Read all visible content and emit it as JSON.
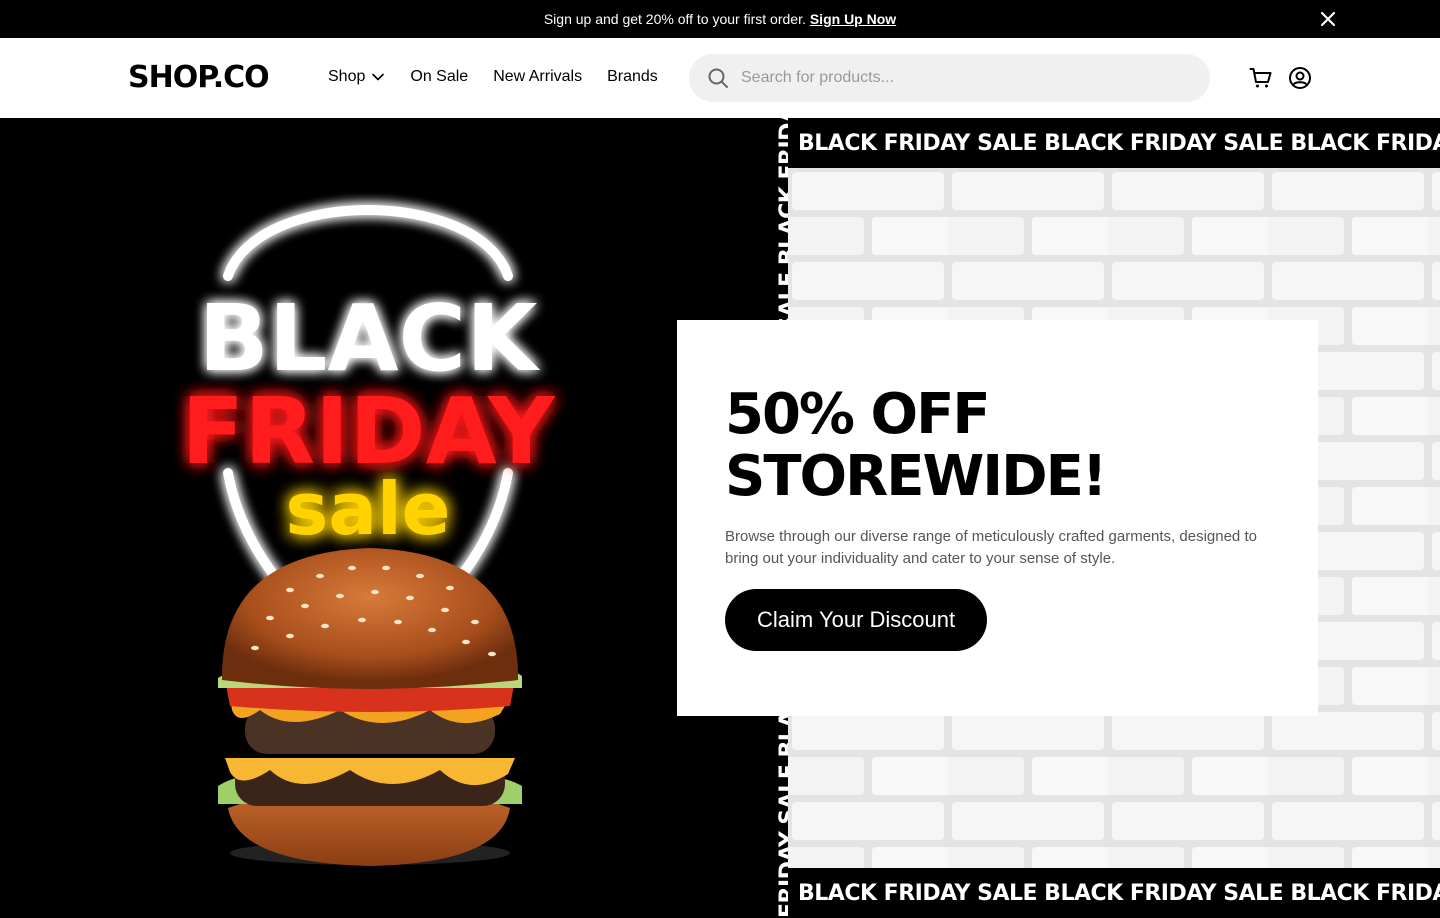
{
  "announcement": {
    "text": "Sign up and get 20% off to your first order.",
    "link_label": "Sign Up Now"
  },
  "header": {
    "logo": "SHOP.CO",
    "nav": [
      {
        "label": "Shop"
      },
      {
        "label": "On Sale"
      },
      {
        "label": "New Arrivals"
      },
      {
        "label": "Brands"
      }
    ],
    "search_placeholder": "Search for products..."
  },
  "hero": {
    "neon": {
      "line1": "BLACK",
      "line2": "FRIDAY",
      "line3": "sale"
    },
    "ticker_text": "BLACK FRIDAY SALE BLACK FRIDAY SALE BLACK FRIDAY SALE BLACK FRIDAY SALE",
    "vertical_ticker_text": "FRIDAY SALE BLACK FRIDAY SALE BLACK FRIDAY SALE BLACK FRIDAY SALE BLACK FRIDAY",
    "promo": {
      "headline": "50% OFF STOREWIDE!",
      "description": "Browse through our diverse range of meticulously crafted garments, designed to bring out your individuality and cater to your sense of style.",
      "cta_label": "Claim Your Discount"
    }
  },
  "colors": {
    "black": "#000000",
    "neon_white": "#ffffff",
    "neon_red": "#ff1a1a",
    "neon_yellow": "#ffd200",
    "search_bg": "#f0f0f0"
  }
}
